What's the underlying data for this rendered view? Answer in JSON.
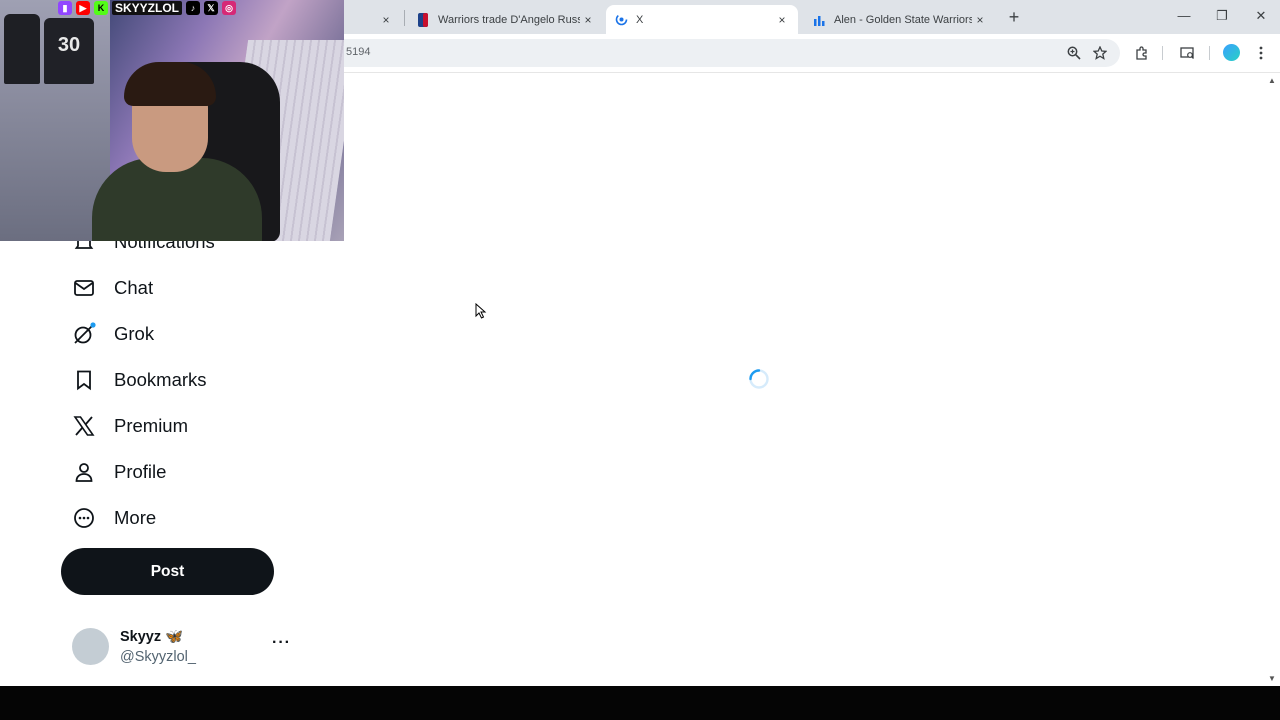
{
  "browser": {
    "tabs": [
      {
        "title": "",
        "active": false
      },
      {
        "title": "Warriors trade D'Angelo Russell",
        "active": false
      },
      {
        "title": "X",
        "active": true
      },
      {
        "title": "Alen - Golden State Warriors Po",
        "active": false
      }
    ],
    "url": "5194",
    "new_tab_symbol": "+",
    "tab_close_symbol": "×",
    "window_controls": {
      "minimize": "—",
      "restore": "❐",
      "close": "✕"
    }
  },
  "webcam": {
    "overlay_text": "SKYYZLOL",
    "jersey_number": "30",
    "badge_icons": [
      "twitch-icon",
      "youtube-icon",
      "kick-icon",
      "tiktok-icon",
      "x-icon",
      "instagram-icon"
    ]
  },
  "sidebar": {
    "items": [
      {
        "label": "Notifications",
        "icon": "bell-icon"
      },
      {
        "label": "Chat",
        "icon": "envelope-icon"
      },
      {
        "label": "Grok",
        "icon": "grok-icon"
      },
      {
        "label": "Bookmarks",
        "icon": "bookmark-icon"
      },
      {
        "label": "Premium",
        "icon": "x-logo-icon"
      },
      {
        "label": "Profile",
        "icon": "person-icon"
      },
      {
        "label": "More",
        "icon": "more-circle-icon"
      }
    ],
    "post_label": "Post",
    "account": {
      "name": "Skyyz 🦋",
      "handle": "@Skyyzlol_",
      "more": "···"
    }
  },
  "colors": {
    "text": "#0f1419",
    "post_button_bg": "#0f1419",
    "spinner": "#1d9bf0",
    "grok_dot": "#1d9bf0"
  }
}
